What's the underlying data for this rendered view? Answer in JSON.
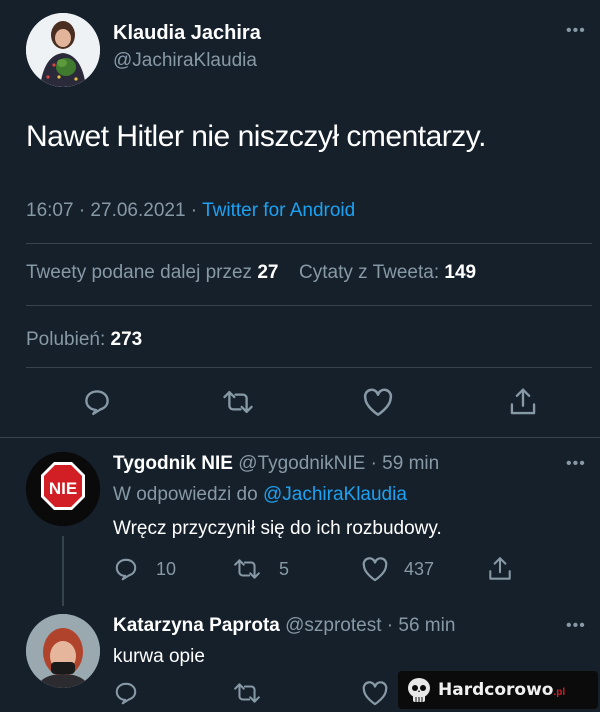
{
  "main_tweet": {
    "author_name": "Klaudia Jachira",
    "author_handle": "@JachiraKlaudia",
    "text": "Nawet Hitler nie niszczył cmentarzy.",
    "time": "16:07 · 27.06.2021 ·",
    "source": "Twitter for Android",
    "retweets_label": "Tweety podane dalej przez",
    "retweets_count": "27",
    "quotes_label": "Cytaty z Tweeta:",
    "quotes_count": "149",
    "likes_label": "Polubień:",
    "likes_count": "273",
    "icons": [
      "reply-icon",
      "retweet-icon",
      "like-icon",
      "share-icon"
    ]
  },
  "replies": [
    {
      "author_name": "Tygodnik NIE",
      "author_handle": "@TygodnikNIE",
      "time": "· 59 min",
      "reply_to_label": "W odpowiedzi do",
      "reply_to_handle": "@JachiraKlaudia",
      "text": "Wręcz przyczynił się do ich rozbudowy.",
      "avatar_text": "NIE",
      "reply_count": "10",
      "retweet_count": "5",
      "like_count": "437"
    },
    {
      "author_name": "Katarzyna Paprota",
      "author_handle": "@szprotest",
      "time": "· 56 min",
      "text": "kurwa opie"
    }
  ],
  "watermark": {
    "text": "Hardcorowo",
    "suffix": ".pl"
  },
  "colors": {
    "background": "#15202b",
    "accent": "#1da1f2",
    "muted": "#8899a6",
    "divider": "#38444d"
  }
}
